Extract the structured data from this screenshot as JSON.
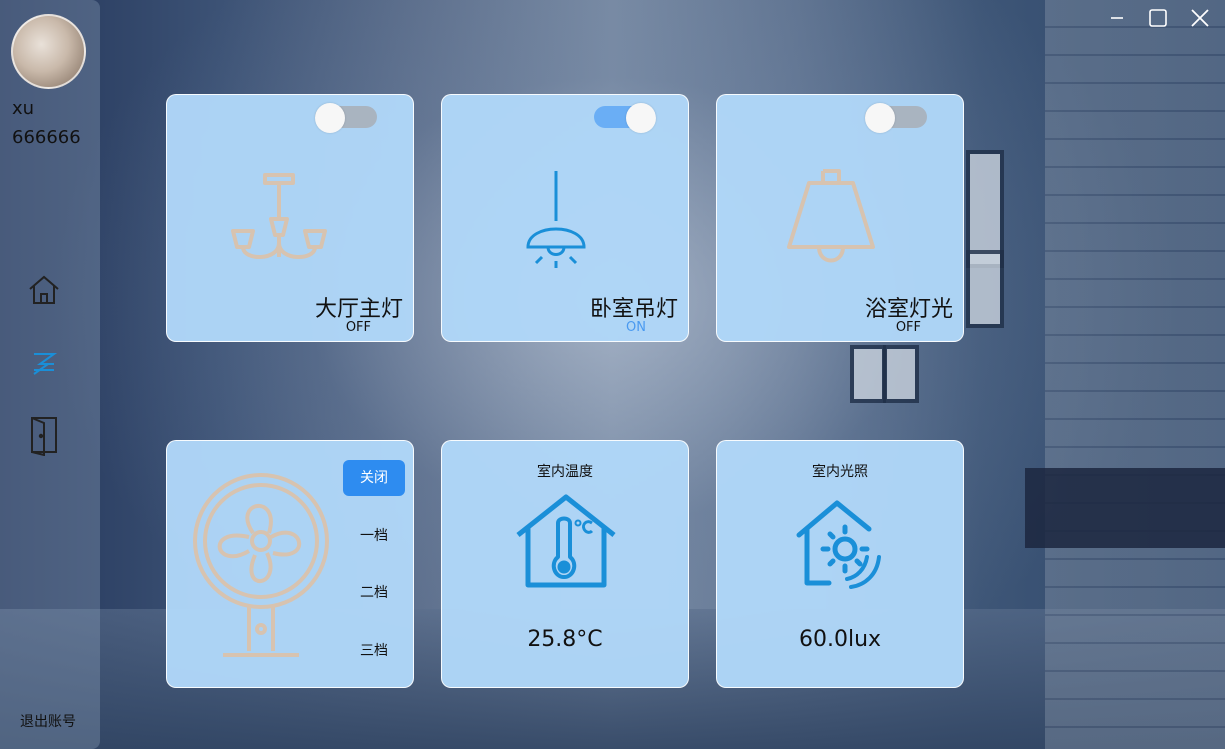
{
  "user": {
    "name": "xu",
    "id": "666666"
  },
  "sidebar": {
    "nav": [
      {
        "icon": "home-icon"
      },
      {
        "icon": "devices-icon",
        "active": true
      },
      {
        "icon": "door-exit-icon"
      }
    ],
    "logout_label": "退出账号"
  },
  "window_controls": [
    "minimize-icon",
    "maximize-icon",
    "close-icon"
  ],
  "lights": [
    {
      "title": "大厅主灯",
      "status": "OFF",
      "on": false,
      "icon": "chandelier-icon"
    },
    {
      "title": "卧室吊灯",
      "status": "ON",
      "on": true,
      "icon": "pendant-lamp-icon"
    },
    {
      "title": "浴室灯光",
      "status": "OFF",
      "on": false,
      "icon": "bell-lamp-icon"
    }
  ],
  "fan": {
    "icon": "fan-icon",
    "buttons": [
      {
        "label": "关闭",
        "active": true
      },
      {
        "label": "一档",
        "active": false
      },
      {
        "label": "二档",
        "active": false
      },
      {
        "label": "三档",
        "active": false
      }
    ]
  },
  "temperature": {
    "label": "室内温度",
    "value": "25.8°C",
    "icon": "house-thermometer-icon"
  },
  "illumination": {
    "label": "室内光照",
    "value": "60.0lux",
    "icon": "house-sun-icon"
  },
  "colors": {
    "accent": "#2e8cf0",
    "icon_blue": "#1a8fd8",
    "icon_off": "#d7c3b0",
    "toggle_on": "#6aaef5",
    "toggle_off": "#a9b4c0",
    "status_on": "#4a9af0"
  }
}
